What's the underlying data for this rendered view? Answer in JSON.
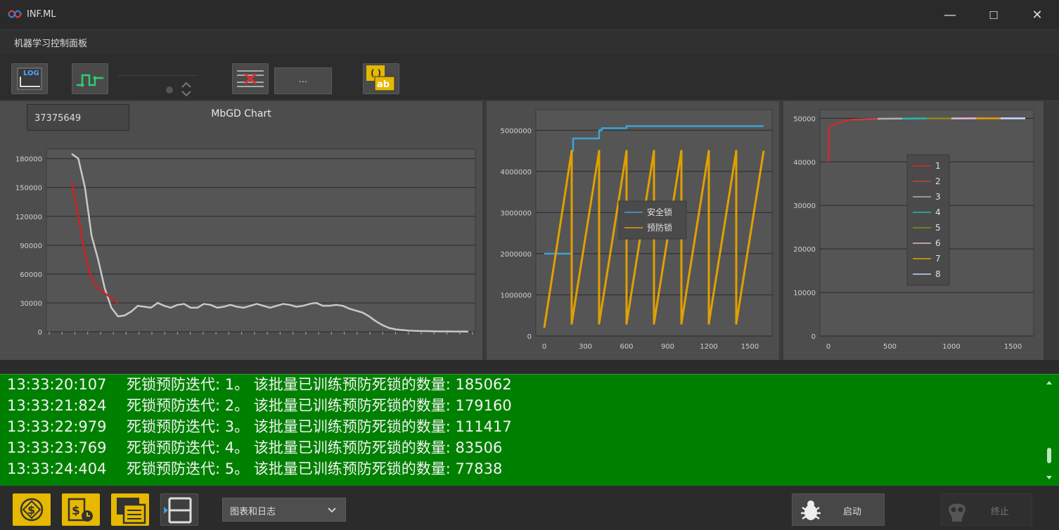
{
  "window": {
    "title": "INF.ML",
    "minimize": "—",
    "maximize": "☐",
    "close": "✕"
  },
  "menu": {
    "panel_label": "机器学习控制面板"
  },
  "toolbar": {
    "ellipsis_label": "..."
  },
  "chart_left_box": "37375649",
  "chart_data": [
    {
      "type": "line",
      "title": "MbGD Chart",
      "ylim": [
        0,
        190000
      ],
      "yticks": [
        0,
        30000,
        60000,
        90000,
        120000,
        150000,
        180000
      ],
      "grid": true,
      "series": [
        {
          "color": "#c8c8c8",
          "values": [
            185000,
            180000,
            150000,
            100000,
            75000,
            45000,
            25000,
            16000,
            17000,
            21000,
            27000,
            26000,
            25000,
            30000,
            27000,
            25000,
            28000,
            29000,
            25000,
            25000,
            29000,
            28000,
            25000,
            26000,
            28000,
            26000,
            25000,
            27000,
            29000,
            27000,
            25000,
            27000,
            29000,
            28000,
            26000,
            27000,
            29000,
            30000,
            27000,
            27000,
            28000,
            27000,
            24000,
            22000,
            20000,
            16000,
            11000,
            7000,
            4000,
            2500,
            1800,
            1200,
            900,
            700,
            600,
            500,
            400,
            350,
            300,
            250,
            200
          ]
        },
        {
          "color": "#cc2222",
          "values": [
            155000,
            120000,
            80000,
            55000,
            45000,
            40000,
            35000,
            30000
          ]
        }
      ]
    },
    {
      "type": "line",
      "title": "",
      "xlim": [
        0,
        1600
      ],
      "ylim": [
        0,
        5500000
      ],
      "xticks": [
        0,
        300,
        600,
        900,
        1200,
        1500
      ],
      "yticks": [
        0,
        1000000,
        2000000,
        3000000,
        4000000,
        5000000
      ],
      "legend": "center-right",
      "series": [
        {
          "name": "安全锁",
          "color": "#3ba4d4",
          "x": [
            0,
            200,
            200,
            210,
            210,
            400,
            400,
            420,
            420,
            600,
            600,
            1600
          ],
          "y": [
            2000000,
            2000000,
            4500000,
            4500000,
            4800000,
            4800000,
            5000000,
            5000000,
            5050000,
            5050000,
            5100000,
            5100000
          ]
        },
        {
          "name": "预防锁",
          "color": "#e0a000",
          "x": [
            0,
            200,
            200,
            400,
            400,
            600,
            600,
            800,
            800,
            1000,
            1000,
            1200,
            1200,
            1400,
            1400,
            1600
          ],
          "y": [
            200000,
            4500000,
            300000,
            4500000,
            300000,
            4500000,
            300000,
            4500000,
            300000,
            4500000,
            300000,
            4500000,
            300000,
            4500000,
            300000,
            4500000
          ]
        }
      ]
    },
    {
      "type": "line",
      "title": "",
      "xlim": [
        0,
        1600
      ],
      "ylim": [
        0,
        52000
      ],
      "xticks": [
        0,
        500,
        1000,
        1500
      ],
      "yticks": [
        0,
        10000,
        20000,
        30000,
        40000,
        50000
      ],
      "legend": "center",
      "series": [
        {
          "name": "1",
          "color": "#d42a2a",
          "x": [
            0,
            5,
            20,
            60,
            120,
            200
          ],
          "y": [
            40000,
            47500,
            48200,
            48800,
            49300,
            49700
          ]
        },
        {
          "name": "2",
          "color": "#c84040",
          "x": [
            200,
            400
          ],
          "y": [
            49700,
            49900
          ]
        },
        {
          "name": "3",
          "color": "#b0b0b0",
          "x": [
            400,
            600
          ],
          "y": [
            49900,
            49950
          ]
        },
        {
          "name": "4",
          "color": "#2ab7b0",
          "x": [
            600,
            800
          ],
          "y": [
            49950,
            49980
          ]
        },
        {
          "name": "5",
          "color": "#8a8a1a",
          "x": [
            800,
            1000
          ],
          "y": [
            49980,
            49990
          ]
        },
        {
          "name": "6",
          "color": "#e6b6d6",
          "x": [
            1000,
            1200
          ],
          "y": [
            49990,
            49995
          ]
        },
        {
          "name": "7",
          "color": "#e6a100",
          "x": [
            1200,
            1400
          ],
          "y": [
            49995,
            49998
          ]
        },
        {
          "name": "8",
          "color": "#c8d8ff",
          "x": [
            1400,
            1600
          ],
          "y": [
            49998,
            50000
          ]
        }
      ]
    }
  ],
  "log": {
    "lines": [
      {
        "time": "13:33:20:107",
        "text": "死锁预防迭代: 1。 该批量已训练预防死锁的数量: 185062"
      },
      {
        "time": "13:33:21:824",
        "text": "死锁预防迭代: 2。 该批量已训练预防死锁的数量: 179160"
      },
      {
        "time": "13:33:22:979",
        "text": "死锁预防迭代: 3。 该批量已训练预防死锁的数量: 111417"
      },
      {
        "time": "13:33:23:769",
        "text": "死锁预防迭代: 4。 该批量已训练预防死锁的数量: 83506"
      },
      {
        "time": "13:33:24:404",
        "text": "死锁预防迭代: 5。 该批量已训练预防死锁的数量: 77838"
      }
    ]
  },
  "bottom": {
    "select_value": "图表和日志",
    "start_label": "启动",
    "stop_label": "终止"
  }
}
